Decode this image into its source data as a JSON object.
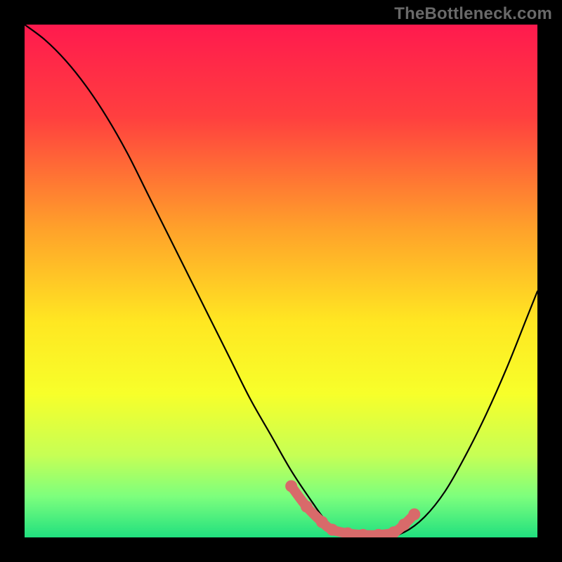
{
  "watermark": "TheBottleneck.com",
  "chart_data": {
    "type": "line",
    "title": "",
    "xlabel": "",
    "ylabel": "",
    "xlim": [
      0,
      100
    ],
    "ylim": [
      0,
      100
    ],
    "gradient_stops": [
      {
        "offset": 0,
        "color": "#ff1a4e"
      },
      {
        "offset": 18,
        "color": "#ff3f3f"
      },
      {
        "offset": 40,
        "color": "#ffa22a"
      },
      {
        "offset": 58,
        "color": "#ffe722"
      },
      {
        "offset": 72,
        "color": "#f7ff2a"
      },
      {
        "offset": 84,
        "color": "#c6ff55"
      },
      {
        "offset": 92,
        "color": "#7dff7d"
      },
      {
        "offset": 100,
        "color": "#21e07f"
      }
    ],
    "series": [
      {
        "name": "bottleneck-curve",
        "x": [
          0,
          4,
          8,
          12,
          16,
          20,
          24,
          28,
          32,
          36,
          40,
          44,
          48,
          52,
          56,
          59,
          62,
          66,
          70,
          74,
          78,
          82,
          86,
          90,
          94,
          98,
          100
        ],
        "values": [
          100,
          97,
          93,
          88,
          82,
          75,
          67,
          59,
          51,
          43,
          35,
          27,
          20,
          13,
          7,
          3,
          1,
          0,
          0,
          1,
          4,
          9,
          16,
          24,
          33,
          43,
          48
        ]
      }
    ],
    "highlight_segment": {
      "name": "optimal-range",
      "color": "#d86a6a",
      "x": [
        52,
        55,
        58,
        60,
        63,
        66,
        69,
        72,
        74,
        76
      ],
      "values": [
        10,
        6,
        3,
        1.5,
        0.8,
        0.5,
        0.5,
        1,
        2.5,
        4.5
      ]
    }
  }
}
